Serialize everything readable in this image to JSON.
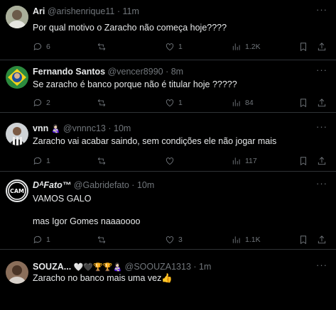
{
  "tweets": [
    {
      "name": "Ari",
      "handle": "@arishenrique11",
      "time": "11m",
      "text": "Por qual motivo o Zaracho não começa hoje????",
      "replies": "6",
      "reposts": "",
      "likes": "1",
      "views": "1.2K"
    },
    {
      "name": "Fernando Santos",
      "handle": "@vencer8990",
      "time": "8m",
      "text": "Se zaracho é banco porque não é titular hoje ?????",
      "replies": "2",
      "reposts": "",
      "likes": "1",
      "views": "84"
    },
    {
      "name": "vnn",
      "name_emoji": "👩🏻‍🍼",
      "handle": "@vnnnc13",
      "time": "10m",
      "text": "Zaracho vai acabar saindo, sem condições ele não jogar mais",
      "replies": "1",
      "reposts": "",
      "likes": "",
      "views": "117"
    },
    {
      "name": "DᴬFato™",
      "handle": "@Gabridefato",
      "time": "10m",
      "text_line1": "VAMOS GALO",
      "text_line2": "mas Igor Gomes naaaoooo",
      "replies": "1",
      "reposts": "",
      "likes": "3",
      "views": "1.1K"
    },
    {
      "name": "SOUZA...",
      "name_emoji": "🤍🖤🏆🏆👩🏻‍🍼",
      "handle": "@SOOUZA1313",
      "time": "1m",
      "text": "Zaracho no banco mais uma vez👍"
    }
  ],
  "separator": "·",
  "more_label": "···",
  "avatar_logo_text": "CAM"
}
